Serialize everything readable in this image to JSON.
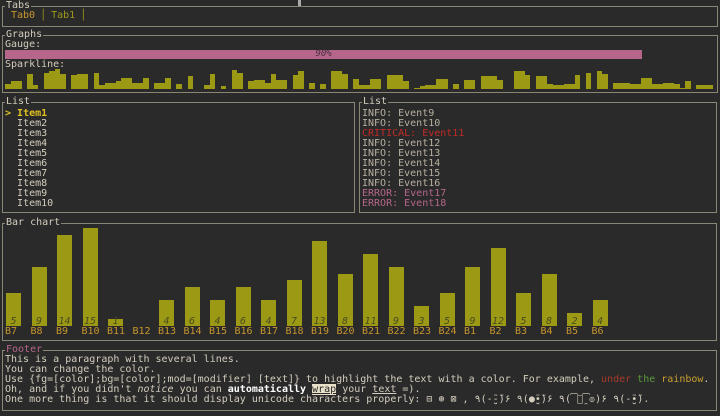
{
  "tabs": {
    "title": "Tabs",
    "items": [
      "Tab0",
      "Tab1"
    ],
    "selected": 0
  },
  "graphs": {
    "title": "Graphs",
    "gauge_label": "Gauge:",
    "gauge_percent": 90,
    "gauge_text": "90%",
    "sparkline_label": "Sparkline:",
    "sparkline": [
      4,
      6,
      6,
      0,
      12,
      3,
      0,
      13,
      14,
      16,
      12,
      0,
      11,
      12,
      12,
      0,
      13,
      3,
      5,
      5,
      6,
      9,
      9,
      5,
      5,
      9,
      0,
      5,
      5,
      9,
      0,
      4,
      0,
      10,
      0,
      0,
      3,
      12,
      0,
      2,
      0,
      15,
      13,
      0,
      6,
      7,
      7,
      5,
      12,
      7,
      7,
      0,
      11,
      14,
      0,
      5,
      0,
      4,
      0,
      14,
      14,
      12,
      0,
      8,
      3,
      3,
      8,
      8,
      0,
      11,
      11,
      11,
      6,
      0,
      1,
      2,
      3,
      3,
      8,
      8,
      0,
      4,
      0,
      7,
      7,
      0,
      10,
      10,
      10,
      7,
      0,
      0,
      14,
      14,
      11,
      0,
      10,
      10,
      4,
      3,
      3,
      4,
      4,
      11,
      0,
      13,
      0,
      14,
      12,
      0,
      5,
      5,
      5,
      4,
      4,
      9,
      9,
      4,
      4,
      5,
      5,
      4,
      1,
      6,
      0,
      3,
      3,
      3
    ]
  },
  "list_left": {
    "title": "List",
    "highlight_symbol": ">",
    "selected": 0,
    "items": [
      "Item1",
      "Item2",
      "Item3",
      "Item4",
      "Item5",
      "Item6",
      "Item7",
      "Item8",
      "Item9",
      "Item10"
    ]
  },
  "list_right": {
    "title": "List",
    "events": [
      {
        "level": "INFO",
        "text": "INFO: Event9"
      },
      {
        "level": "INFO",
        "text": "INFO: Event10"
      },
      {
        "level": "CRITICAL",
        "text": "CRITICAL: Event11"
      },
      {
        "level": "INFO",
        "text": "INFO: Event12"
      },
      {
        "level": "INFO",
        "text": "INFO: Event13"
      },
      {
        "level": "INFO",
        "text": "INFO: Event14"
      },
      {
        "level": "INFO",
        "text": "INFO: Event15"
      },
      {
        "level": "INFO",
        "text": "INFO: Event16"
      },
      {
        "level": "ERROR",
        "text": "ERROR: Event17"
      },
      {
        "level": "ERROR",
        "text": "ERROR: Event18"
      }
    ]
  },
  "chart_data": {
    "type": "bar",
    "title": "Bar chart",
    "categories": [
      "B7",
      "B8",
      "B9",
      "B10",
      "B11",
      "B12",
      "B13",
      "B14",
      "B15",
      "B16",
      "B17",
      "B18",
      "B19",
      "B20",
      "B21",
      "B22",
      "B23",
      "B24",
      "B1",
      "B2",
      "B3",
      "B4",
      "B5",
      "B6"
    ],
    "values": [
      5,
      9,
      14,
      15,
      1,
      0,
      4,
      6,
      4,
      6,
      4,
      7,
      13,
      8,
      11,
      9,
      3,
      5,
      9,
      12,
      5,
      8,
      2,
      4
    ],
    "ylim": [
      0,
      15
    ]
  },
  "footer": {
    "title": "Footer",
    "line1": "This is a paragraph with several lines.",
    "line2": "You can change the color.",
    "line3a": "Use {fg=[color];bg=[color];mod=[modifier] [text]} to highlight the text with a color. For example, ",
    "line3_under": "under",
    "line3_the": "the",
    "line3_rainbow": "rainbow",
    "line3_end": ".",
    "line4a": "Oh, and if you didn't ",
    "line4_notice": "notice",
    "line4b": " you can ",
    "line4_auto": "automatically",
    "line4c": " ",
    "line4_wrap": "wrap",
    "line4d": " your ",
    "line4_text": "text",
    "line4e": " =).",
    "line5": "One more thing is that it should display unicode characters properly: ⊟ ⊛ ⊠ , ٩(-̮̮̃-̃)۶ ٩(●̮̮̃•̃)۶ ٩(͡๏̯͡๏)۶ ٩(-̮̮̃•̃)."
  },
  "colors": {
    "bg": "#2a2a2a",
    "border": "#8a8676",
    "bar": "#9c9a14",
    "gauge": "#b5668a",
    "label": "#c8962e",
    "critical": "#c02a26",
    "error": "#b5668a"
  }
}
